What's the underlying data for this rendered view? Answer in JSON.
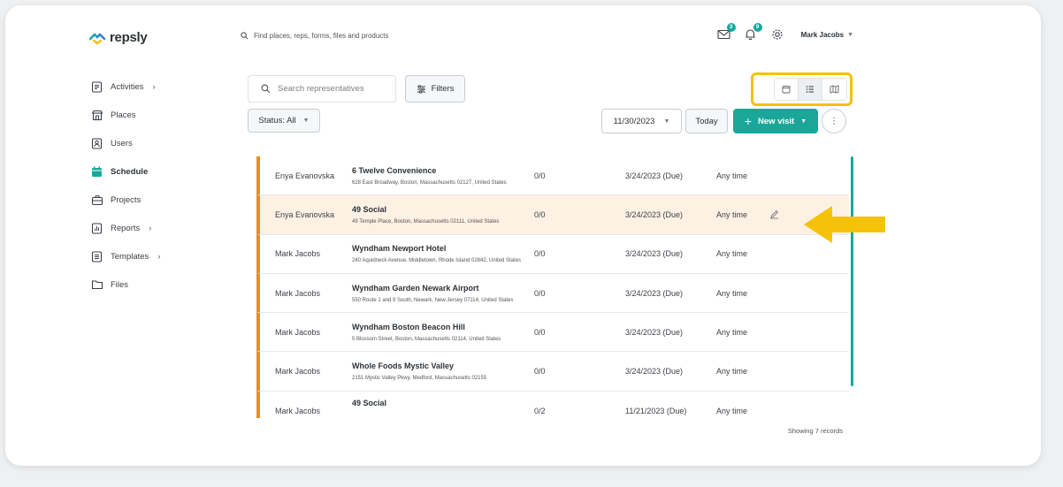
{
  "brand": {
    "name": "repsly"
  },
  "global_search": {
    "placeholder": "Find places, reps, forms, files and products"
  },
  "header": {
    "mail_badge": "3",
    "notif_badge": "9",
    "user_name": "Mark Jacobs",
    "icons": [
      "mail-icon",
      "bell-icon",
      "gear-icon"
    ]
  },
  "sidebar": {
    "items": [
      {
        "label": "Activities",
        "has_chevron": true
      },
      {
        "label": "Places",
        "has_chevron": false
      },
      {
        "label": "Users",
        "has_chevron": false
      },
      {
        "label": "Schedule",
        "has_chevron": false,
        "active": true
      },
      {
        "label": "Projects",
        "has_chevron": false
      },
      {
        "label": "Reports",
        "has_chevron": true
      },
      {
        "label": "Templates",
        "has_chevron": true
      },
      {
        "label": "Files",
        "has_chevron": false
      }
    ]
  },
  "toolbar": {
    "search_placeholder": "Search representatives",
    "filters_label": "Filters",
    "status_label": "Status: All",
    "date_label": "11/30/2023",
    "today_label": "Today",
    "new_visit_label": "New visit",
    "active_view": "list"
  },
  "visits": [
    {
      "rep": "Enya Evanovska",
      "place": "6 Twelve Convenience",
      "address": "628 East Broadway, Boston, Massachusetts 02127, United States",
      "count": "0/0",
      "date": "3/24/2023 (Due)",
      "time": "Any time"
    },
    {
      "rep": "Enya Evanovska",
      "place": "49 Social",
      "address": "49 Temple Place, Boston, Massachusetts 02111, United States",
      "count": "0/0",
      "date": "3/24/2023 (Due)",
      "time": "Any time",
      "highlighted": true
    },
    {
      "rep": "Mark Jacobs",
      "place": "Wyndham Newport Hotel",
      "address": "240 Aquidneck Avenue, Middletown, Rhode Island 02842, United States",
      "count": "0/0",
      "date": "3/24/2023 (Due)",
      "time": "Any time"
    },
    {
      "rep": "Mark Jacobs",
      "place": "Wyndham Garden Newark Airport",
      "address": "550 Route 1 and 9 South, Newark, New Jersey 07114, United States",
      "count": "0/0",
      "date": "3/24/2023 (Due)",
      "time": "Any time"
    },
    {
      "rep": "Mark Jacobs",
      "place": "Wyndham Boston Beacon Hill",
      "address": "5 Blossom Street, Boston, Massachusetts 02114, United States",
      "count": "0/0",
      "date": "3/24/2023 (Due)",
      "time": "Any time"
    },
    {
      "rep": "Mark Jacobs",
      "place": "Whole Foods Mystic Valley",
      "address": "2151 Mystic Valley Pkwy, Medford, Massachusetts 02155",
      "count": "0/0",
      "date": "3/24/2023 (Due)",
      "time": "Any time"
    },
    {
      "rep": "Mark Jacobs",
      "place": "49 Social",
      "address": "",
      "count": "0/2",
      "date": "11/21/2023 (Due)",
      "time": "Any time"
    }
  ],
  "footer": {
    "records_text": "Showing 7 records"
  },
  "colors": {
    "accent": "#1aa79a",
    "row_marker": "#f08b1e",
    "highlight": "#f5c20a"
  }
}
